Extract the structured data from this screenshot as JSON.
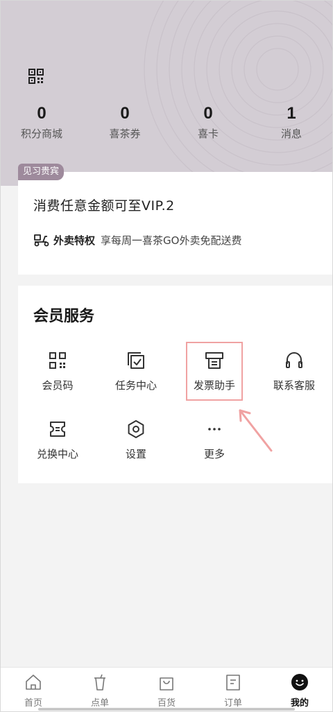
{
  "header": {
    "qr_icon": "qr-code-icon",
    "stats": [
      {
        "value": "0",
        "label": "积分商城"
      },
      {
        "value": "0",
        "label": "喜茶券"
      },
      {
        "value": "0",
        "label": "喜卡"
      },
      {
        "value": "1",
        "label": "消息"
      }
    ]
  },
  "member": {
    "badge": "见习贵宾",
    "title": "消费任意金额可至VIP.2",
    "perk_name": "外卖特权",
    "perk_desc": "享每周一喜茶GO外卖免配送费"
  },
  "services": {
    "title": "会员服务",
    "items": [
      {
        "label": "会员码",
        "icon": "qr-code-icon"
      },
      {
        "label": "任务中心",
        "icon": "task-icon"
      },
      {
        "label": "发票助手",
        "icon": "invoice-icon"
      },
      {
        "label": "联系客服",
        "icon": "headset-icon"
      },
      {
        "label": "兑换中心",
        "icon": "ticket-icon"
      },
      {
        "label": "设置",
        "icon": "settings-icon"
      },
      {
        "label": "更多",
        "icon": "more-icon"
      }
    ]
  },
  "bottom_nav": {
    "items": [
      {
        "label": "首页",
        "icon": "home-icon"
      },
      {
        "label": "点单",
        "icon": "cup-icon"
      },
      {
        "label": "百货",
        "icon": "bag-icon"
      },
      {
        "label": "订单",
        "icon": "order-icon"
      },
      {
        "label": "我的",
        "icon": "profile-icon"
      }
    ],
    "active": "我的"
  },
  "colors": {
    "header_bg": "#d3cdd4",
    "badge_bg": "#9e8a9c",
    "highlight": "#f0a2a2"
  }
}
